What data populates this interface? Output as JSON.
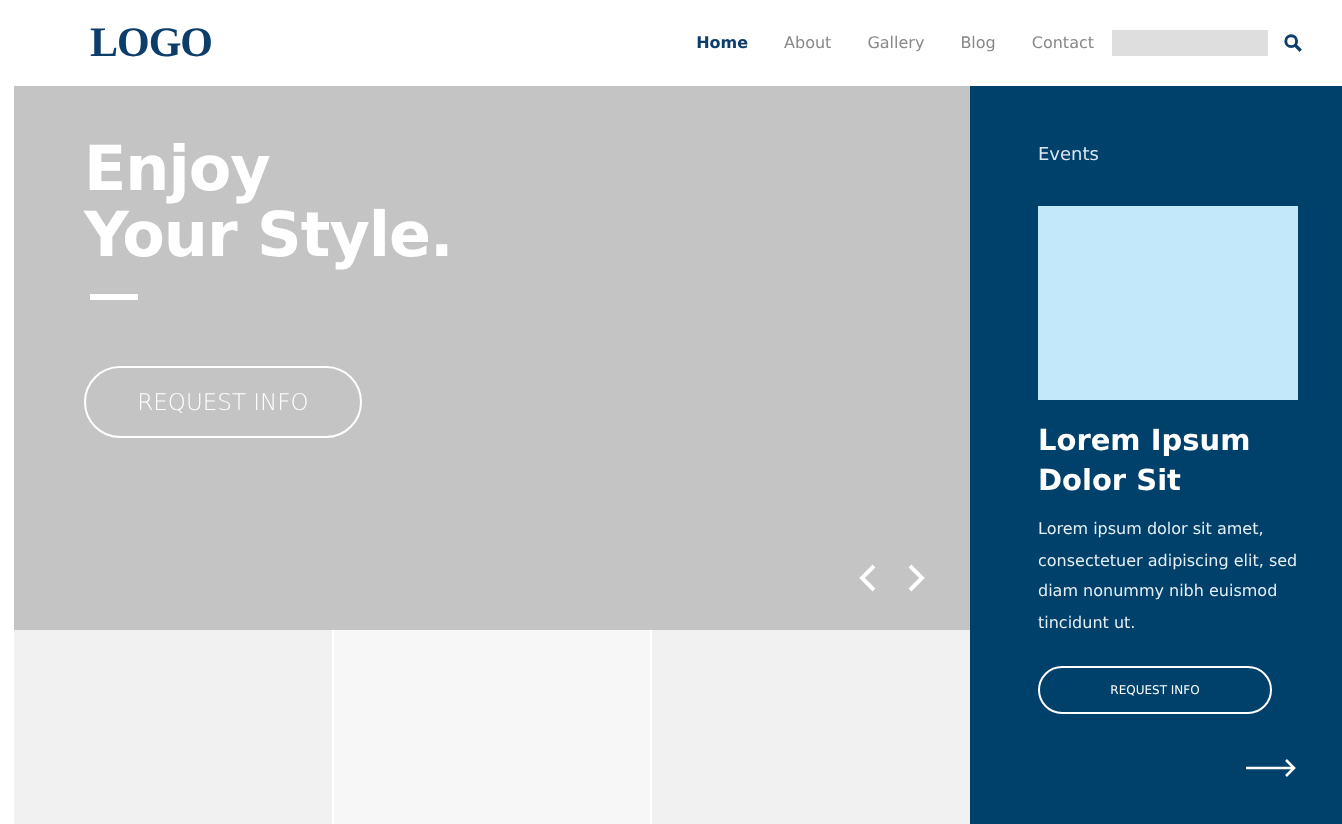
{
  "header": {
    "logo": "LOGO",
    "nav": [
      {
        "label": "Home",
        "selected": true
      },
      {
        "label": "About",
        "selected": false
      },
      {
        "label": "Gallery",
        "selected": false
      },
      {
        "label": "Blog",
        "selected": false
      },
      {
        "label": "Contact",
        "selected": false
      }
    ]
  },
  "hero": {
    "headline": [
      "Enjoy",
      "Your Style."
    ],
    "button": "REQUEST INFO"
  },
  "events": {
    "label": "Events",
    "title": "Lorem Ipsum Dolor Sit",
    "body": "Lorem ipsum dolor sit amet, consectetuer adipiscing elit, sed diam nonummy nibh euismod tincidunt ut.",
    "button": "REQUEST INFO"
  }
}
